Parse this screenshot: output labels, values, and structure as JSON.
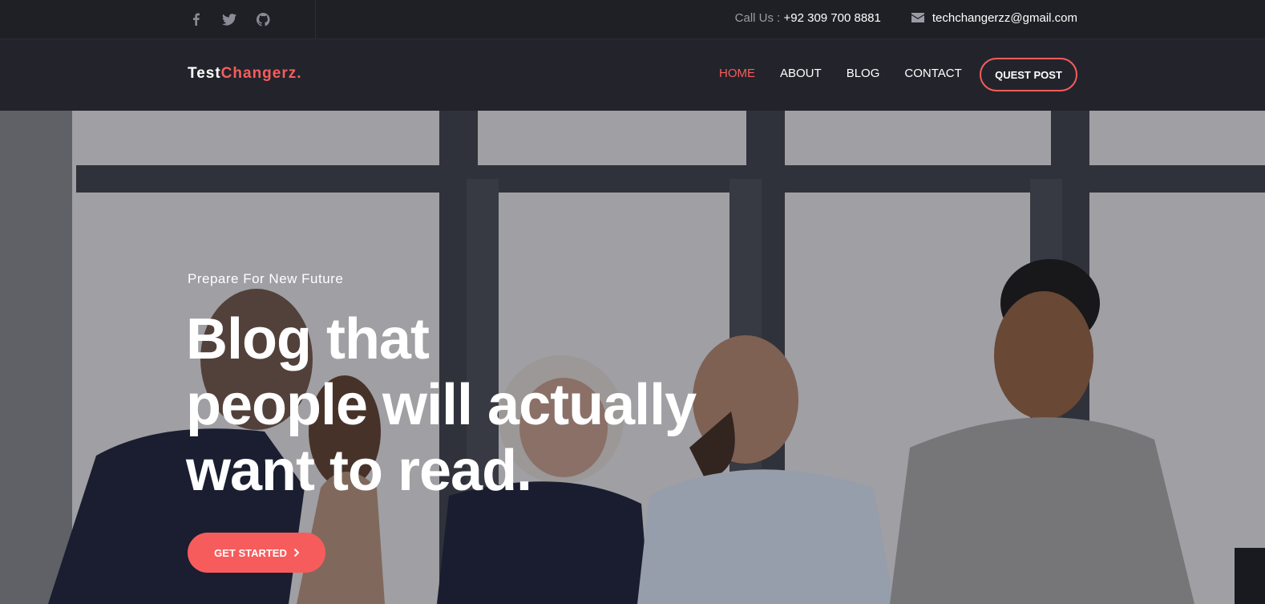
{
  "topbar": {
    "social": [
      {
        "icon": "facebook-icon"
      },
      {
        "icon": "twitter-icon"
      },
      {
        "icon": "github-icon"
      }
    ],
    "call_label": "Call Us : ",
    "call_number": "+92 309 700 8881",
    "email": "techchangerzz@gmail.com"
  },
  "nav": {
    "logo_part1": "Test",
    "logo_part2": "Changerz.",
    "items": [
      {
        "label": "HOME",
        "active": true
      },
      {
        "label": "ABOUT",
        "active": false
      },
      {
        "label": "BLOG",
        "active": false
      },
      {
        "label": "CONTACT",
        "active": false
      }
    ],
    "quest_post_label": "QUEST POST"
  },
  "hero": {
    "tagline": "Prepare For New Future",
    "headline_lines": [
      "Blog that",
      "people will actually",
      "want to read."
    ],
    "cta_label": "GET STARTED"
  },
  "colors": {
    "accent": "#f75c5c",
    "dark_bg": "#1f2026",
    "nav_bg": "#23242b"
  }
}
